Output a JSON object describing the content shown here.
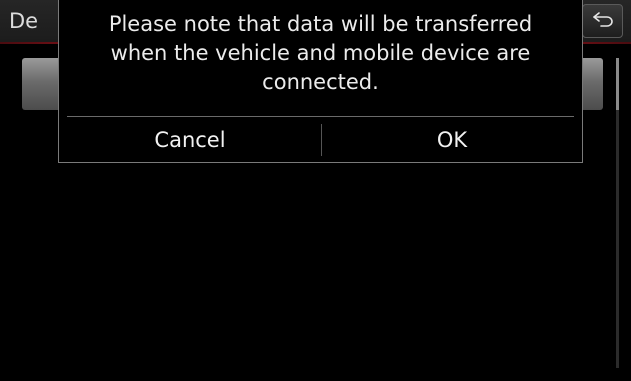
{
  "header": {
    "title": "De",
    "back_icon": "back-arrow-icon"
  },
  "colors": {
    "accent_line": "#c4141f",
    "background": "#000000"
  },
  "dialog": {
    "message_lines": [
      "Please note that data will be transferred",
      "when the vehicle and mobile device are",
      "connected."
    ],
    "cancel_label": "Cancel",
    "ok_label": "OK"
  }
}
